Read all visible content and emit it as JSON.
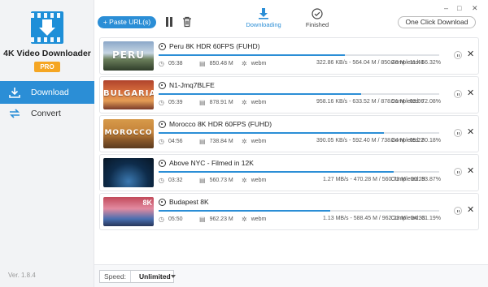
{
  "app": {
    "name": "4K Video Downloader",
    "badge": "PRO",
    "version": "Ver. 1.8.4"
  },
  "sidebar": {
    "items": [
      {
        "label": "Download",
        "icon": "download-icon",
        "active": true
      },
      {
        "label": "Convert",
        "icon": "convert-icon",
        "active": false
      }
    ]
  },
  "toolbar": {
    "paste_label": "+ Paste URL(s)",
    "tabs": [
      {
        "label": "Downloading",
        "icon": "download-arrow-icon",
        "active": true
      },
      {
        "label": "Finished",
        "icon": "check-circle-icon",
        "active": false
      }
    ],
    "one_click_label": "One Click Download",
    "window": {
      "minimize": "–",
      "restore": "□",
      "close": "✕"
    }
  },
  "downloads": [
    {
      "title": "Peru 8K HDR 60FPS (FUHD)",
      "thumb_text": "PERU",
      "thumb_dur": "",
      "duration": "05:38",
      "size": "850.48 M",
      "format": "webm",
      "speed": "322.86 KB/s - 564.04 M / 850.48 M - 11:48",
      "completed": "Completed: 66.32%",
      "progress": 66.32
    },
    {
      "title": "N1-Jmq7BLFE",
      "thumb_text": "BULGARIA",
      "thumb_dur": "",
      "duration": "05:39",
      "size": "878.91 M",
      "format": "webm",
      "speed": "958.16 KB/s - 633.52 M / 878.91 M - 03:06",
      "completed": "Completed: 72.08%",
      "progress": 72.08
    },
    {
      "title": "Morocco 8K HDR 60FPS (FUHD)",
      "thumb_text": "MOROCCO",
      "thumb_dur": "",
      "duration": "04:56",
      "size": "738.84 M",
      "format": "webm",
      "speed": "390.05 KB/s - 592.40 M / 738.84 M - 05:22",
      "completed": "Completed: 80.18%",
      "progress": 80.18
    },
    {
      "title": "Above NYC - Filmed in 12K",
      "thumb_text": "",
      "thumb_dur": "",
      "duration": "03:32",
      "size": "560.73 M",
      "format": "webm",
      "speed": "1.27 MB/s - 470.28 M / 560.73 M - 00:29",
      "completed": "Completed: 83.87%",
      "progress": 83.87
    },
    {
      "title": "Budapest 8K",
      "thumb_text": "",
      "thumb_dur": "8K",
      "duration": "05:50",
      "size": "962.23 M",
      "format": "webm",
      "speed": "1.13 MB/s - 588.45 M / 962.23 M - 04:33",
      "completed": "Completed: 61.19%",
      "progress": 61.19
    }
  ],
  "bottom": {
    "speed_label": "Speed:",
    "speed_value": "Unlimited"
  },
  "colors": {
    "accent": "#2b8ed6",
    "pro_badge": "#f5a623"
  }
}
